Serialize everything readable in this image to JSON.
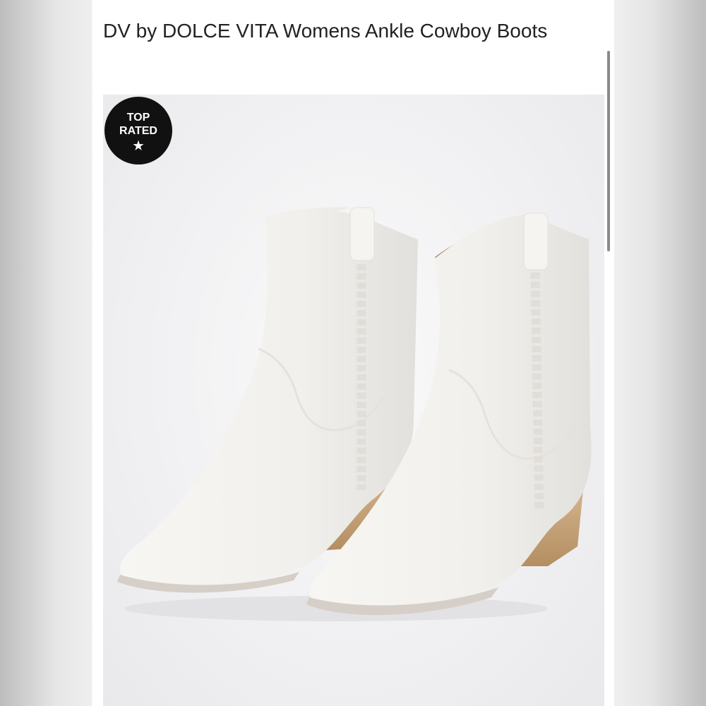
{
  "product": {
    "title": "DV by DOLCE VITA Womens Ankle Cowboy Boots",
    "badge": {
      "line1": "TOP",
      "line2": "RATED",
      "icon": "star-icon",
      "color": "#111111"
    }
  },
  "colors": {
    "boot": "#f3f2ef",
    "heel": "#c9a981",
    "sole": "#d6cfc7",
    "lining": "#b88863"
  }
}
